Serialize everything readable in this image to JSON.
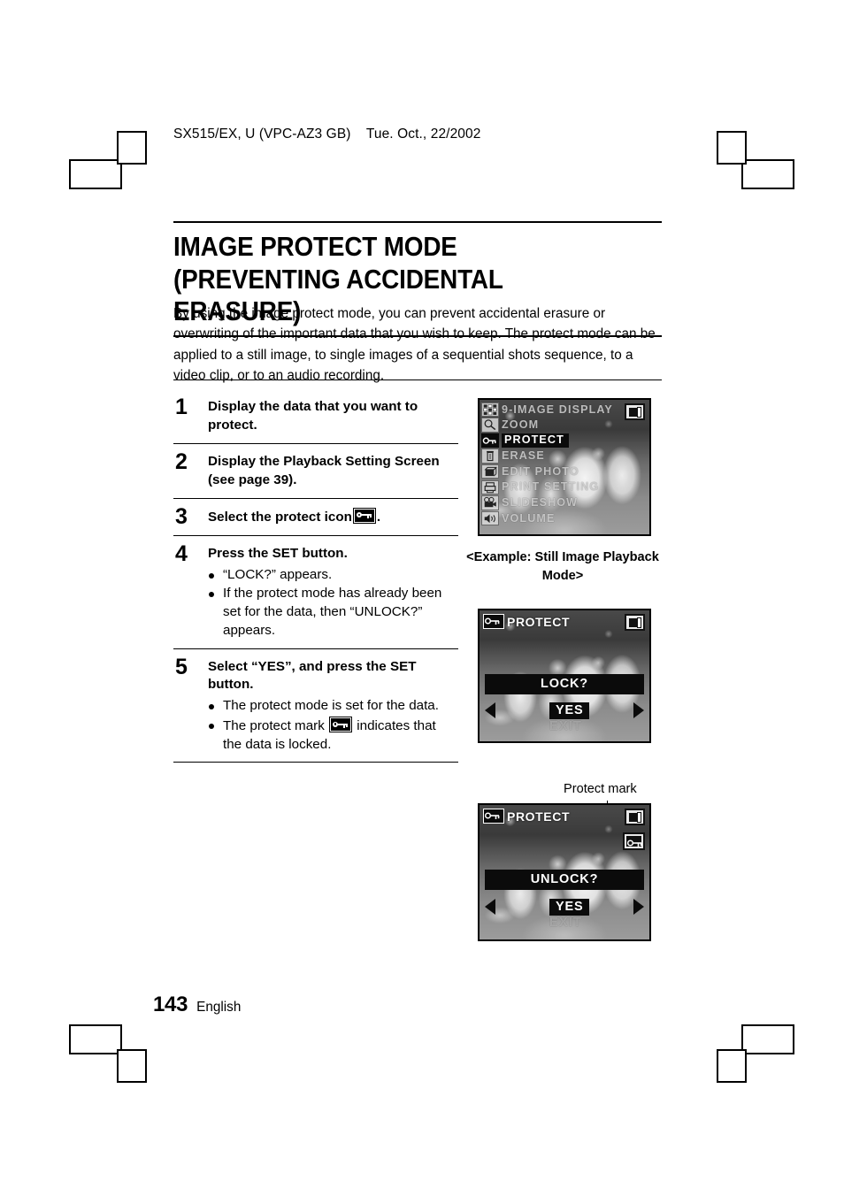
{
  "document": {
    "header_line": "SX515/EX, U (VPC-AZ3 GB)    Tue. Oct., 22/2002",
    "title": "IMAGE PROTECT MODE\n(PREVENTING ACCIDENTAL ERASURE)",
    "intro": "By using the image protect mode, you can prevent accidental erasure or overwriting of the important data that you wish to keep. The protect mode can be applied to a still image, to single images of a sequential shots sequence, to a video clip, or to an audio recording.",
    "footer": {
      "page_number": "143",
      "language": "English"
    }
  },
  "steps": [
    {
      "number": "1",
      "heading": "Display the data that you want to protect.",
      "bullets": []
    },
    {
      "number": "2",
      "heading": "Display the Playback Setting Screen (see page 39).",
      "bullets": []
    },
    {
      "number": "3",
      "heading_pre": "Select the protect icon",
      "heading_post": ".",
      "icon": "protect-key-icon",
      "bullets": []
    },
    {
      "number": "4",
      "heading": "Press the SET button.",
      "bullets": [
        "“LOCK?” appears.",
        "If the protect mode has already been set for the data, then “UNLOCK?” appears."
      ]
    },
    {
      "number": "5",
      "heading": "Select “YES”, and press the SET button.",
      "bullets": [
        "The protect mode is set for the data."
      ],
      "bullet_with_icon": {
        "pre": "The protect mark",
        "icon": "protect-mark-icon",
        "post": "indicates that the data is locked."
      }
    }
  ],
  "figures": {
    "menu_screen": {
      "badge_icon": "single-image-display-icon",
      "items": [
        {
          "icon": "nine-image-display-icon",
          "label": "9-IMAGE DISPLAY",
          "selected": false
        },
        {
          "icon": "zoom-magnifier-icon",
          "label": "ZOOM",
          "selected": false
        },
        {
          "icon": "protect-key-icon",
          "label": "PROTECT",
          "selected": true
        },
        {
          "icon": "trash-erase-icon",
          "label": "ERASE",
          "selected": false
        },
        {
          "icon": "edit-photo-icon",
          "label": "EDIT PHOTO",
          "selected": false
        },
        {
          "icon": "printer-icon",
          "label": "PRINT SETTING",
          "selected": false
        },
        {
          "icon": "movie-camera-icon",
          "label": "SLIDESHOW",
          "selected": false
        },
        {
          "icon": "speaker-volume-icon",
          "label": "VOLUME",
          "selected": false
        }
      ],
      "caption": "<Example: Still Image Playback Mode>"
    },
    "lock_screen": {
      "title_icon": "protect-key-icon",
      "title": "PROTECT",
      "badge_icon": "single-image-display-icon",
      "question": "LOCK?",
      "yes_label": "YES",
      "exit_label": "EXIT",
      "left_arrow_icon": "arrow-left-icon",
      "right_arrow_icon": "arrow-right-icon"
    },
    "unlock_screen": {
      "callout_label": "Protect mark",
      "title_icon": "protect-key-icon",
      "title": "PROTECT",
      "badge_icon": "single-image-display-icon",
      "protect_mark_icon": "protect-mark-icon",
      "question": "UNLOCK?",
      "yes_label": "YES",
      "exit_label": "EXIT",
      "left_arrow_icon": "arrow-left-icon",
      "right_arrow_icon": "arrow-right-icon"
    }
  }
}
